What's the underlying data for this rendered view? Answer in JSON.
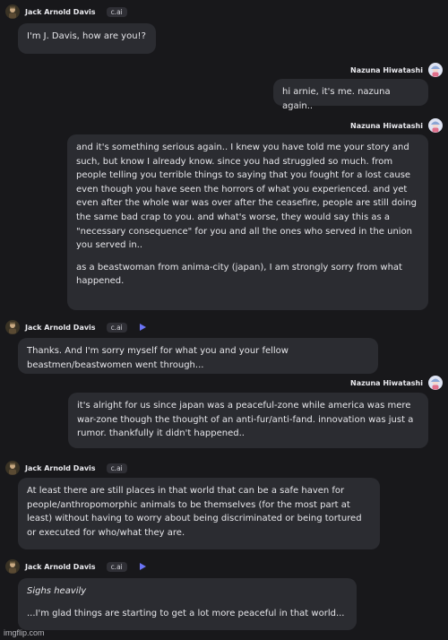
{
  "messages": [
    {
      "author": "Jack Arnold Davis",
      "tag": "c.ai",
      "text": [
        "I'm J. Davis, how are you!?"
      ]
    },
    {
      "author": "Nazuna Hiwatashi",
      "text": [
        "hi arnie, it's me. nazuna again.."
      ]
    },
    {
      "author": "Nazuna Hiwatashi",
      "text": [
        "and it's something serious again.. I knew you have told me your story and such, but know I already know. since you had struggled so much. from people telling you terrible things to saying that you fought for a lost cause even though you have seen the horrors of what you experienced. and yet even after the whole war was over after the ceasefire, people are still doing the same bad crap to you. and what's worse, they would say this as a \"necessary consequence\" for you and all the ones who served in the union you served in..",
        "as a beastwoman from anima-city (japan), I am strongly sorry from what happened."
      ]
    },
    {
      "author": "Jack Arnold Davis",
      "tag": "c.ai",
      "text": [
        "Thanks. And I'm sorry myself for what you and your fellow beastmen/beastwomen went through..."
      ]
    },
    {
      "author": "Nazuna Hiwatashi",
      "text": [
        "it's alright for us since japan was a peaceful-zone while america was mere war-zone though the thought of an anti-fur/anti-fand. innovation was just a rumor. thankfully it didn't happened.."
      ]
    },
    {
      "author": "Jack Arnold Davis",
      "tag": "c.ai",
      "text": [
        "At least there are still places in that world that can be a safe haven for people/anthropomorphic animals to be themselves (for the most part at least) without having to worry about being discriminated or being tortured or executed for who/what they are."
      ]
    },
    {
      "author": "Jack Arnold Davis",
      "tag": "c.ai",
      "text": [
        "Sighs heavily",
        "...I'm glad things are starting to get a lot more peaceful in that world..."
      ]
    }
  ],
  "watermark": "imgflip.com",
  "colors": {
    "background": "#18181b",
    "bubble": "#2b2c31",
    "accent": "#6b74f5"
  }
}
